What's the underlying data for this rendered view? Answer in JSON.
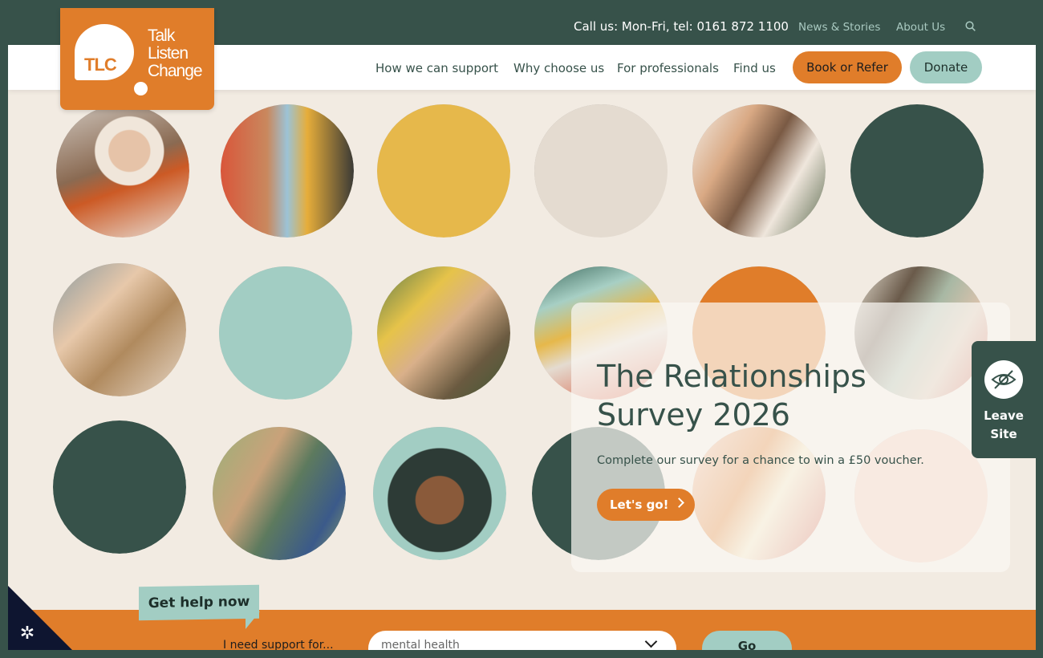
{
  "header": {
    "call": "Call us: Mon-Fri, tel: 0161 872 1100",
    "top_links": [
      "News & Stories",
      "About Us"
    ],
    "search_icon": "search-icon"
  },
  "logo": {
    "badge": "TLC",
    "words": [
      "Talk",
      "Listen",
      "Change"
    ]
  },
  "nav": {
    "items": [
      "How we can support",
      "Why choose us",
      "For professionals",
      "Find us"
    ],
    "book": "Book or Refer",
    "donate": "Donate"
  },
  "hero": {
    "title": "The Relationships Survey 2026",
    "description": "Complete our survey for a chance to win a £50 voucher.",
    "cta": "Let's go!"
  },
  "leave_site": {
    "icon": "eye-slash-icon",
    "label": "Leave Site"
  },
  "help": {
    "tag": "Get help now",
    "prompt": "I need support for...",
    "select_value": "mental health",
    "go": "Go"
  },
  "cookie": {
    "icon": "cookie-settings-icon"
  },
  "colors": {
    "orange": "#e07d2a",
    "dark_green": "#37524a",
    "mint": "#a2cdc3",
    "yellow": "#e6b84b",
    "beige": "#e4dbd0",
    "peach": "#f2c8b4",
    "background": "#f2ebe2"
  }
}
